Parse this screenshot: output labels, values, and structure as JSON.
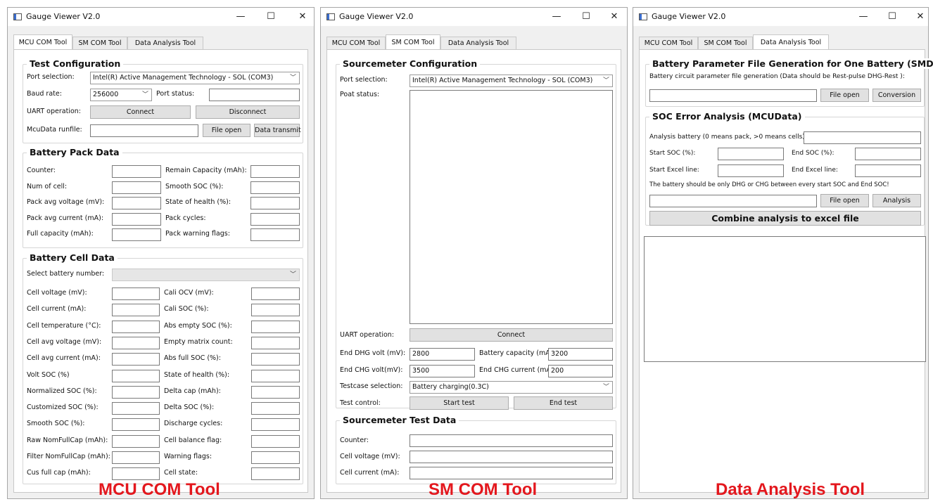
{
  "title": "Gauge Viewer V2.0",
  "tabs": [
    "MCU COM Tool",
    "SM COM Tool",
    "Data Analysis Tool"
  ],
  "captions": [
    "MCU COM Tool",
    "SM COM Tool",
    "Data Analysis Tool"
  ],
  "window_controls": {
    "minimize": "—",
    "maximize": "☐",
    "close": "✕"
  },
  "mcu": {
    "test_config": {
      "title": "Test Configuration",
      "port_label": "Port selection:",
      "port_value": "Intel(R) Active Management Technology - SOL (COM3)",
      "baud_label": "Baud rate:",
      "baud_value": "256000",
      "port_status_label": "Port status:",
      "uart_label": "UART operation:",
      "connect": "Connect",
      "disconnect": "Disconnect",
      "runfile_label": "McuData runfile:",
      "file_open": "File open",
      "data_transmit": "Data transmit"
    },
    "pack": {
      "title": "Battery Pack Data",
      "left": [
        "Counter:",
        "Num of cell:",
        "Pack avg voltage (mV):",
        "Pack avg current (mA):",
        "Full capacity (mAh):"
      ],
      "right": [
        "Remain Capacity (mAh):",
        "Smooth SOC (%):",
        "State of health (%):",
        "Pack cycles:",
        "Pack warning flags:"
      ]
    },
    "cell": {
      "title": "Battery Cell Data",
      "select_label": "Select battery number:",
      "left": [
        "Cell voltage (mV):",
        "Cell current (mA):",
        "Cell temperature (°C):",
        "Cell avg voltage (mV):",
        "Cell avg current (mA):",
        "Volt SOC (%)",
        "Normalized SOC (%):",
        "Customized SOC (%):",
        "Smooth SOC (%):",
        "Raw NomFullCap (mAh):",
        "Filter NomFullCap (mAh):",
        "Cus full cap (mAh):"
      ],
      "right": [
        "Cali OCV (mV):",
        "Cali SOC (%):",
        "Abs empty SOC (%):",
        "Empty matrix count:",
        "Abs full SOC (%):",
        "State of health (%):",
        "Delta cap (mAh):",
        "Delta SOC (%):",
        "Discharge cycles:",
        "Cell balance flag:",
        "Warning flags:",
        "Cell state:"
      ]
    }
  },
  "sm": {
    "config": {
      "title": "Sourcemeter Configuration",
      "port_label": "Port selection:",
      "port_value": "Intel(R) Active Management Technology - SOL (COM3)",
      "status_label": "Poat status:",
      "uart_label": "UART operation:",
      "connect": "Connect",
      "end_dhg_label": "End DHG volt (mV):",
      "end_dhg_value": "2800",
      "capacity_label": "Battery capacity (mAh",
      "capacity_value": "3200",
      "end_chg_label": "End CHG volt(mV):",
      "end_chg_value": "3500",
      "end_chg_current_label": "End CHG current (mA",
      "end_chg_current_value": "200",
      "testcase_label": "Testcase selection:",
      "testcase_value": "Battery charging(0.3C)",
      "control_label": "Test control:",
      "start_test": "Start test",
      "end_test": "End test"
    },
    "test_data": {
      "title": "Sourcemeter Test Data",
      "labels": [
        "Counter:",
        "Cell voltage (mV):",
        "Cell current (mA):"
      ]
    }
  },
  "da": {
    "param": {
      "title": "Battery Parameter File Generation for One Battery (SMData)",
      "desc": "Battery circuit parameter file generation (Data should be Rest-pulse DHG-Rest ):",
      "file_open": "File open",
      "conversion": "Conversion"
    },
    "soc": {
      "title": "SOC Error Analysis (MCUData)",
      "battery_label": "Analysis battery (0 means pack, >0 means cells):",
      "start_soc": "Start SOC (%):",
      "end_soc": "End SOC (%):",
      "start_excel": "Start Excel line:",
      "end_excel": "End Excel line:",
      "note": "The battery should be only DHG or CHG between every start SOC and End SOC!",
      "file_open": "File open",
      "analysis": "Analysis",
      "combine": "Combine analysis to excel file"
    }
  }
}
